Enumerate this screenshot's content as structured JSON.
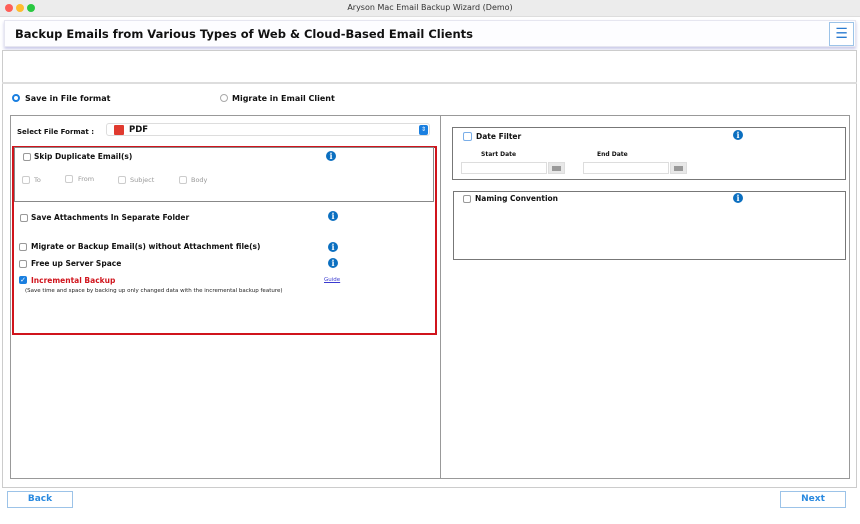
{
  "window": {
    "title": "Aryson Mac Email Backup Wizard (Demo)"
  },
  "header": {
    "title": "Backup Emails from Various Types of Web & Cloud-Based Email Clients",
    "menu_icon": "☰"
  },
  "mode": {
    "options": [
      {
        "label": "Save in File format",
        "selected": true
      },
      {
        "label": "Migrate in Email Client",
        "selected": false
      }
    ]
  },
  "left": {
    "format_label": "Select File Format  :",
    "format_value": "PDF",
    "skip_duplicates": {
      "label": "Skip Duplicate Email(s)",
      "checked": false,
      "fields": [
        "To",
        "From",
        "Subject",
        "Body"
      ]
    },
    "options": [
      {
        "label": "Save Attachments In Separate Folder",
        "checked": false
      },
      {
        "label": "Migrate or Backup Email(s) without Attachment file(s)",
        "checked": false
      },
      {
        "label": "Free up Server Space",
        "checked": false
      }
    ],
    "incremental": {
      "label": "Incremental Backup",
      "checked": true,
      "guide": "Guide",
      "note": "(Save time and space by backing up only changed data with the incremental backup feature)"
    }
  },
  "right": {
    "date_filter": {
      "label": "Date Filter",
      "start": "Start Date",
      "end": "End Date"
    },
    "naming": {
      "label": "Naming Convention"
    }
  },
  "footer": {
    "back": "Back",
    "next": "Next"
  },
  "colors": {
    "accent": "#1a7fe0",
    "highlight": "#d0141c"
  }
}
